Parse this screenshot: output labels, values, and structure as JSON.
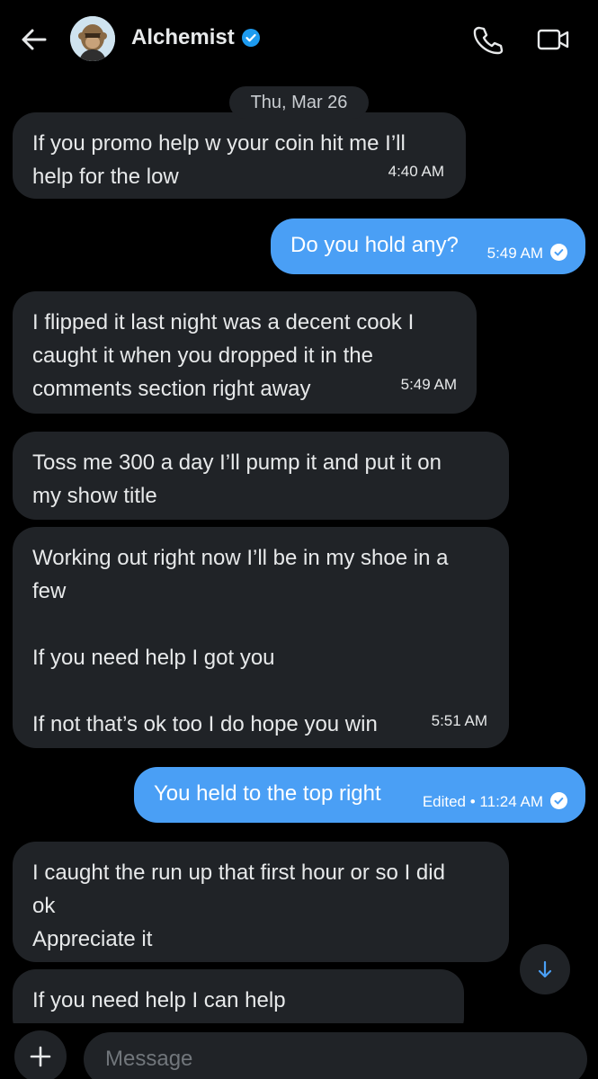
{
  "header": {
    "title": "Alchemist",
    "back_icon": "arrow-left-icon",
    "verified_icon": "verified-badge-icon",
    "call_icon": "phone-icon",
    "video_icon": "video-camera-icon"
  },
  "date_divider": "Thu, Mar 26",
  "messages": [
    {
      "dir": "in",
      "lines": [
        "If you promo help w your coin hit me I’ll",
        "help for the low"
      ],
      "time": "4:40 AM"
    },
    {
      "dir": "out",
      "lines": [
        "Do you hold any?"
      ],
      "time": "5:49 AM",
      "read": true
    },
    {
      "dir": "in",
      "lines": [
        "I flipped it last night was a decent cook I",
        "caught it when you dropped it in the",
        "comments section right away"
      ],
      "time": "5:49 AM"
    },
    {
      "dir": "in",
      "lines": [
        "Toss me 300 a day I’ll pump it and put it on",
        "my show title"
      ]
    },
    {
      "dir": "in",
      "lines": [
        "Working out right now I’ll be in my shoe in a",
        "few",
        "",
        "If you need help I got you",
        "",
        "If not that’s ok too I do hope you win"
      ],
      "time": "5:51 AM"
    },
    {
      "dir": "out",
      "lines": [
        "You held to the top right"
      ],
      "edited_label": "Edited",
      "time": "11:24 AM",
      "read": true
    },
    {
      "dir": "in",
      "lines": [
        "I caught the run up that first hour or so I did",
        "ok",
        "Appreciate it"
      ]
    },
    {
      "dir": "in",
      "lines": [
        "If you need help I can help"
      ]
    }
  ],
  "composer": {
    "placeholder": "Message",
    "add_icon": "plus-icon"
  },
  "scroll_down_icon": "arrow-down-icon",
  "colors": {
    "background": "#000000",
    "incoming_bubble": "#202327",
    "outgoing_bubble": "#4a9ff5",
    "verified": "#1d9bf0"
  }
}
